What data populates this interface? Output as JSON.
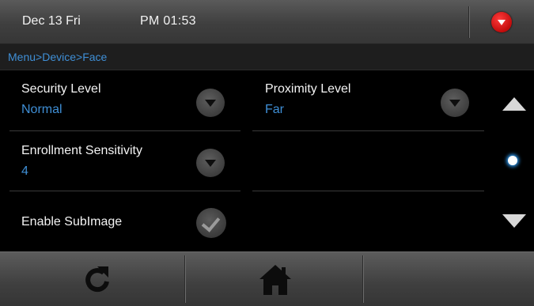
{
  "status_bar": {
    "date": "Dec 13 Fri",
    "time": "PM 01:53",
    "menu_icon": "dropdown-circle-red-icon",
    "menu_color": "#e01818"
  },
  "breadcrumb": {
    "items": [
      "Menu",
      "Device",
      "Face"
    ],
    "separator": ">",
    "color": "#3f8fd6"
  },
  "settings": {
    "security_level": {
      "label": "Security Level",
      "value": "Normal"
    },
    "proximity_level": {
      "label": "Proximity Level",
      "value": "Far"
    },
    "enrollment_sensitivity": {
      "label": "Enrollment Sensitivity",
      "value": "4"
    },
    "enable_subimage": {
      "label": "Enable SubImage",
      "checked": true
    }
  },
  "scroll": {
    "up_icon": "triangle-up-icon",
    "down_icon": "triangle-down-icon",
    "page_indicator_icon": "page-dot-icon"
  },
  "bottom_bar": {
    "left_icon": "refresh-icon",
    "center_icon": "home-icon"
  },
  "colors": {
    "accent": "#3f8fd6",
    "background": "#000000",
    "value_text": "#3f8fd6",
    "label_text": "#f4f4f4"
  }
}
